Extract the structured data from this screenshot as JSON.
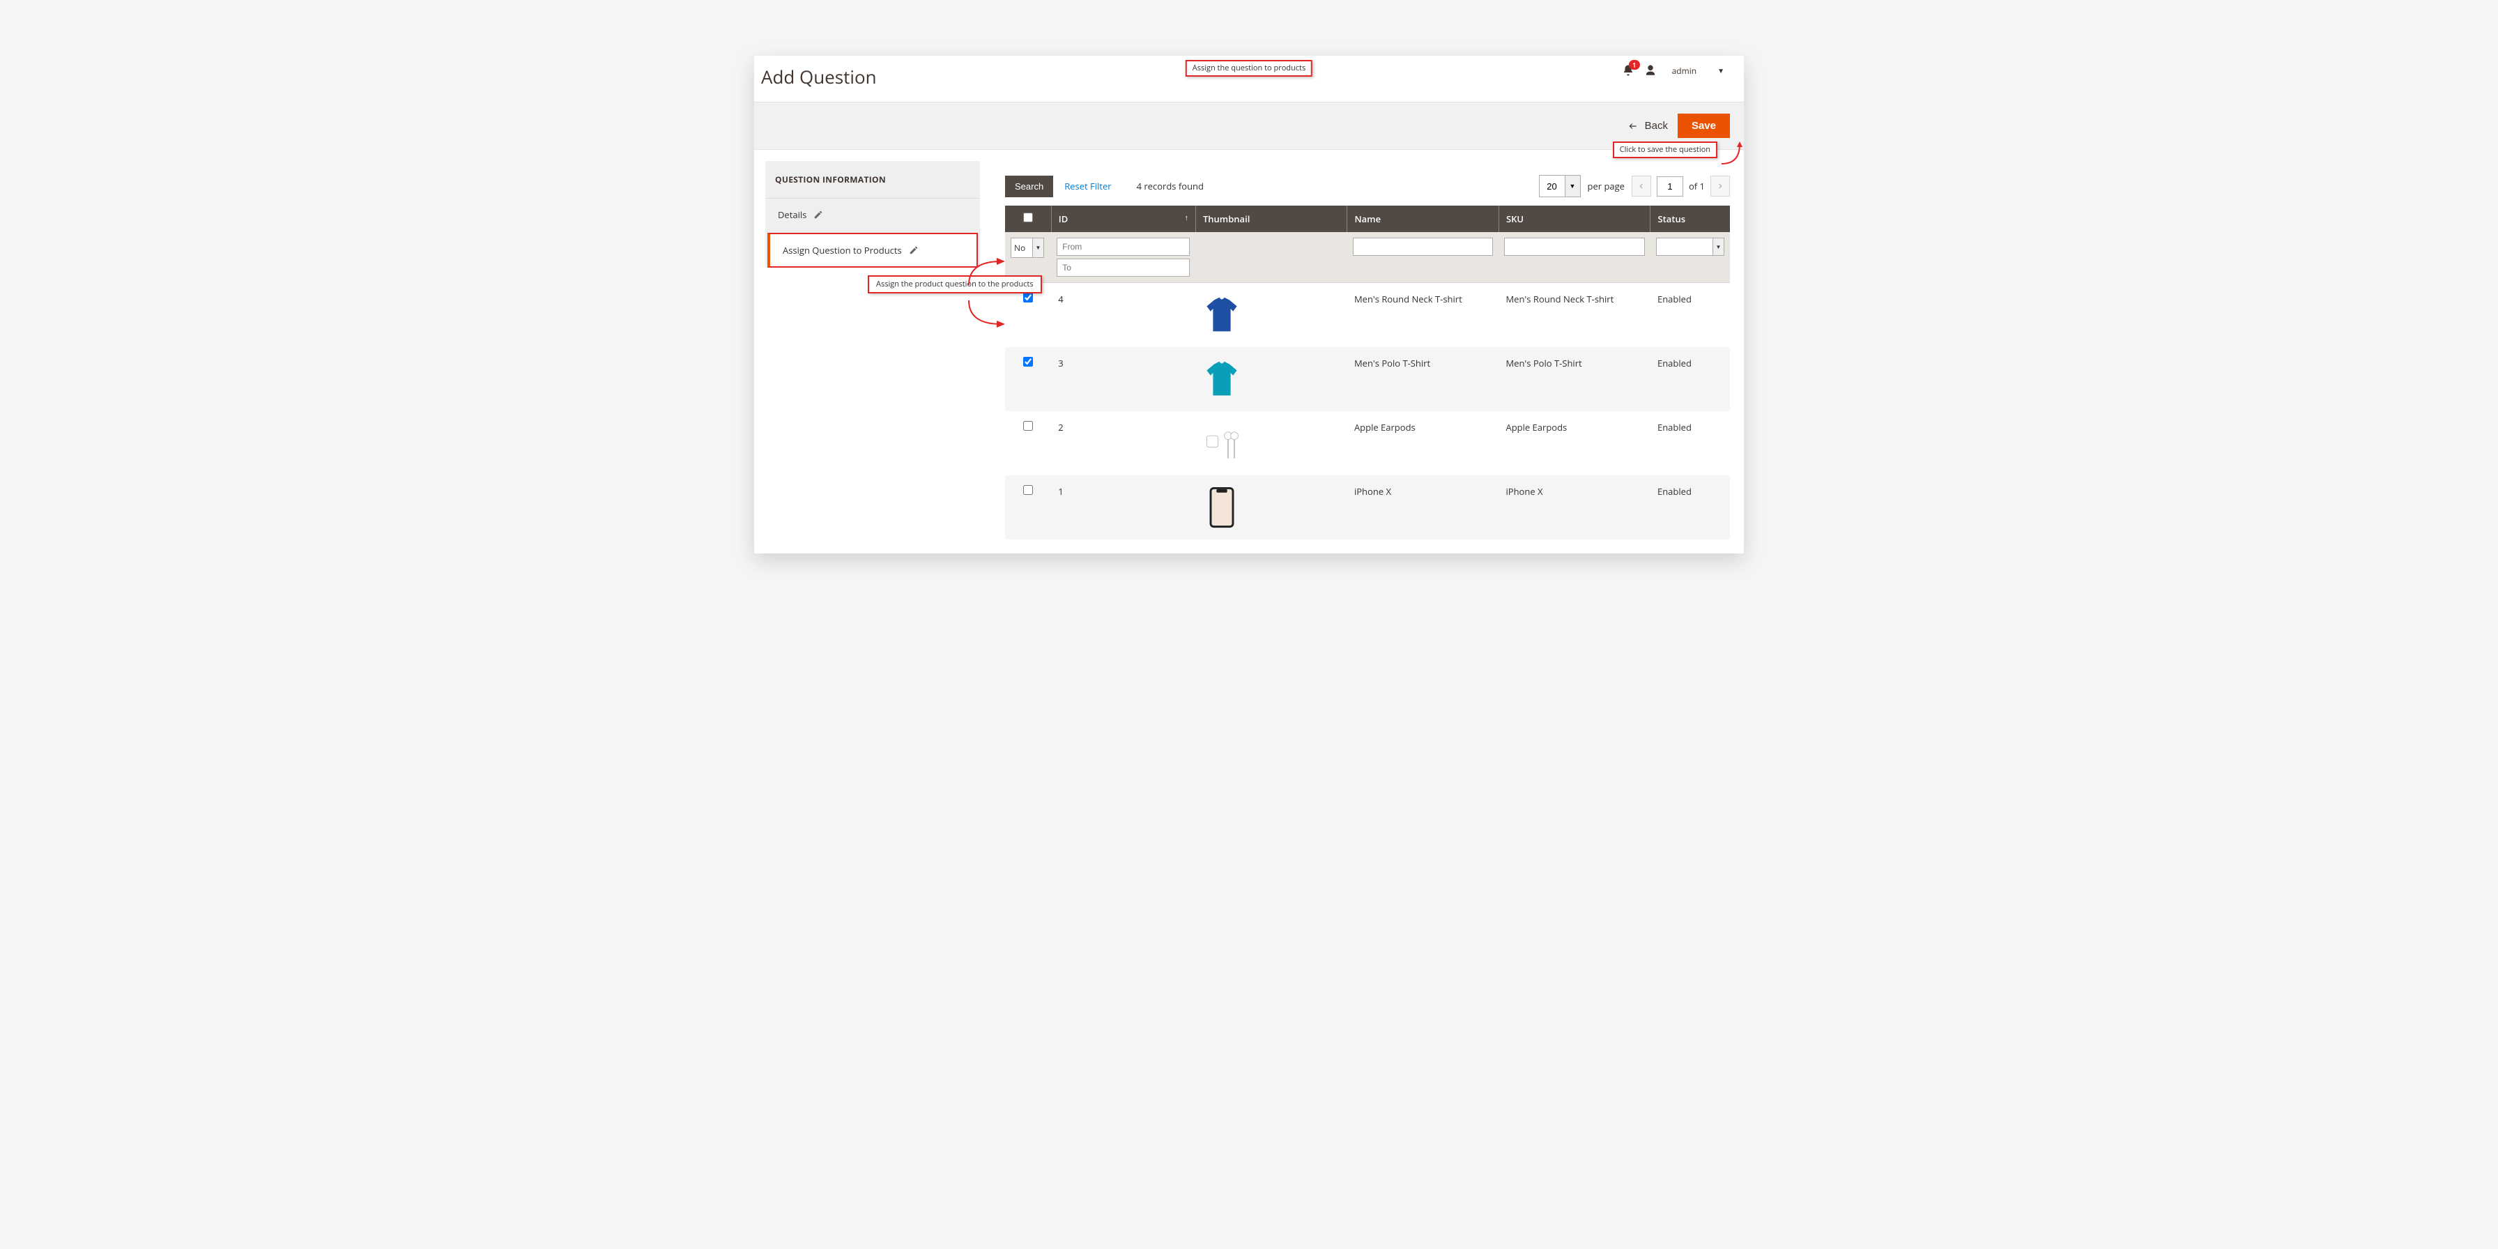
{
  "header": {
    "title": "Add Question",
    "notifications": "1",
    "admin_label": "admin"
  },
  "callouts": {
    "top": "Assign the question to products",
    "save": "Click to save the question",
    "assign": "Assign the product question to the products"
  },
  "actions": {
    "back": "Back",
    "save": "Save"
  },
  "sidebar": {
    "panel_title": "QUESTION INFORMATION",
    "items": [
      {
        "label": "Details",
        "active": false
      },
      {
        "label": "Assign Question to Products",
        "active": true
      }
    ]
  },
  "toolbar": {
    "search": "Search",
    "reset": "Reset Filter",
    "records": "4 records found",
    "per_page_value": "20",
    "per_page_label": "per page",
    "page_value": "1",
    "of_label": "of 1"
  },
  "filters": {
    "select_value": "No",
    "id_from_placeholder": "From",
    "id_to_placeholder": "To"
  },
  "columns": {
    "id": "ID",
    "thumbnail": "Thumbnail",
    "name": "Name",
    "sku": "SKU",
    "status": "Status"
  },
  "rows": [
    {
      "checked": true,
      "id": "4",
      "name": "Men's Round Neck T-shirt",
      "sku": "Men's Round Neck T-shirt",
      "status": "Enabled",
      "thumb_color": "#1e4fa3",
      "thumb_type": "tshirt"
    },
    {
      "checked": true,
      "id": "3",
      "name": "Men's Polo T-Shirt",
      "sku": "Men's Polo T-Shirt",
      "status": "Enabled",
      "thumb_color": "#0a9fb8",
      "thumb_type": "polo"
    },
    {
      "checked": false,
      "id": "2",
      "name": "Apple Earpods",
      "sku": "Apple Earpods",
      "status": "Enabled",
      "thumb_color": "#d9d9d9",
      "thumb_type": "earpods"
    },
    {
      "checked": false,
      "id": "1",
      "name": "iPhone X",
      "sku": "iPhone X",
      "status": "Enabled",
      "thumb_color": "#333333",
      "thumb_type": "phone"
    }
  ]
}
